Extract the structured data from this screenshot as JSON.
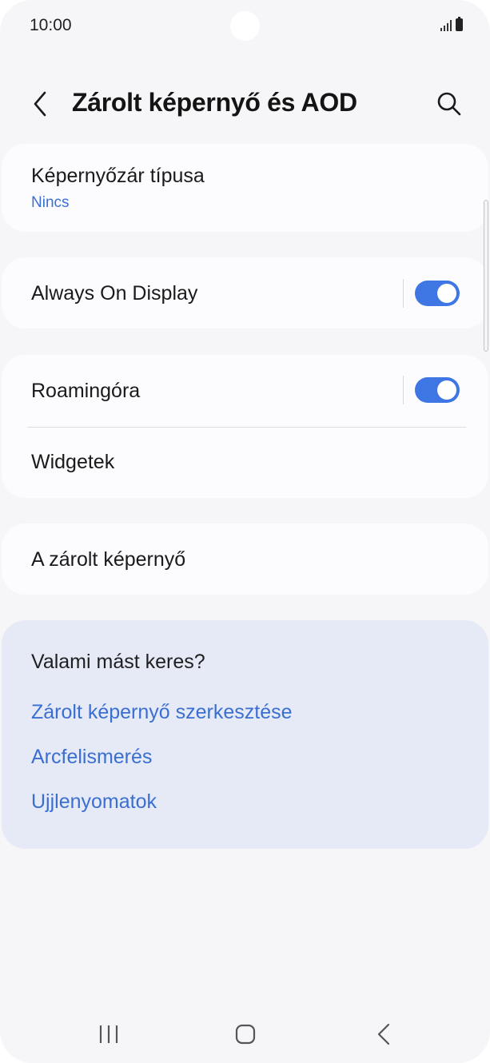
{
  "status_bar": {
    "time": "10:00",
    "signal_icon": "signal-icon",
    "battery_icon": "battery-icon"
  },
  "header": {
    "title": "Zárolt képernyő és AOD",
    "back_icon": "chevron-left-icon",
    "search_icon": "search-icon"
  },
  "settings": {
    "lock_type": {
      "label": "Képernyőzár típusa",
      "value": "Nincs"
    },
    "aod": {
      "label": "Always On Display",
      "enabled": true
    },
    "roaming_clock": {
      "label": "Roamingóra",
      "enabled": true
    },
    "widgets": {
      "label": "Widgetek"
    },
    "lock_screen": {
      "label": "A zárolt képernyő"
    }
  },
  "suggestions": {
    "title": "Valami mást keres?",
    "links": [
      "Zárolt képernyő szerkesztése",
      "Arcfelismerés",
      "Ujjlenyomatok"
    ]
  },
  "nav_bar": {
    "recents_icon": "recents-icon",
    "home_icon": "home-icon",
    "back_icon": "back-icon"
  },
  "colors": {
    "accent": "#3e76e3",
    "link": "#3a6fd1",
    "background": "#f6f6f8",
    "card": "#fcfcfe",
    "suggest_card": "#e6eaf6"
  }
}
